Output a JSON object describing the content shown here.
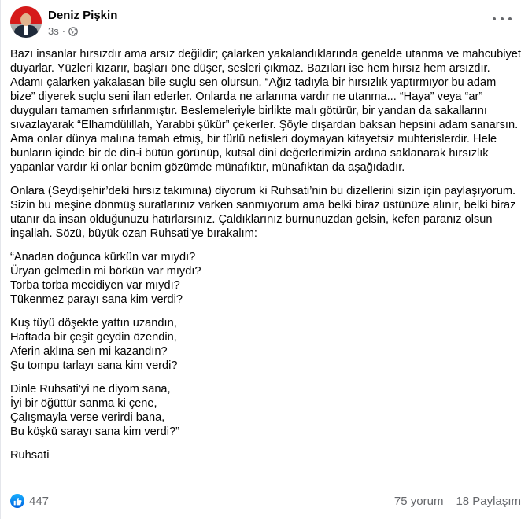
{
  "header": {
    "name": "Deniz Pişkin",
    "time": "3s",
    "separator": "·",
    "audience_icon": "globe-icon"
  },
  "post": {
    "paragraphs": [
      "Bazı insanlar hırsızdır ama arsız değildir; çalarken yakalandıklarında genelde utanma ve mahcubiyet duyarlar. Yüzleri kızarır, başları öne düşer, sesleri çıkmaz. Bazıları ise hem hırsız hem arsızdır. Adamı çalarken yakalasan bile suçlu sen olursun, “Ağız tadıyla bir hırsızlık yaptırmıyor bu adam bize” diyerek suçlu seni ilan ederler. Onlarda ne arlanma vardır ne utanma... “Haya” veya “ar” duyguları tamamen sıfırlanmıştır. Beslemeleriyle birlikte malı götürür, bir yandan da sakallarını sıvazlayarak “Elhamdülillah, Yarabbi şükür” çekerler. Şöyle dışardan baksan hepsini adam sanarsın. Ama onlar dünya malına tamah etmiş, bir türlü nefisleri doymayan kifayetsiz muhterislerdir. Hele bunların içinde bir de din-i bütün görünüp, kutsal dini değerlerimizin ardına saklanarak hırsızlık yapanlar vardır ki onlar benim gözümde münafıktır, münafıktan da aşağıdadır.",
      "Onlara (Seydişehir’deki hırsız takımına) diyorum ki Ruhsati’nin bu dizellerini sizin için paylaşıyorum. Sizin bu meşine dönmüş suratlarınız varken sanmıyorum ama belki biraz üstünüze alınır, belki biraz utanır da insan olduğunuzu hatırlarsınız. Çaldıklarınız burnunuzdan gelsin, kefen paranız olsun inşallah. Sözü, büyük ozan Ruhsati’ye bırakalım:"
    ],
    "stanzas": [
      [
        "“Anadan doğunca kürkün var mıydı?",
        "Üryan gelmedin mi börkün var mıydı?",
        "Torba torba mecidiyen var mıydı?",
        "Tükenmez parayı sana kim verdi?"
      ],
      [
        "Kuş tüyü döşekte yattın uzandın,",
        "Haftada bir çeşit geydin özendin,",
        "Aferin aklına sen mi kazandın?",
        "Şu tompu tarlayı sana kim verdi?"
      ],
      [
        "Dinle Ruhsati’yi ne diyom sana,",
        "İyi bir öğüttür sanma ki çene,",
        "Çalışmayla verse verirdi bana,",
        "Bu köşkü sarayı sana kim verdi?”"
      ]
    ],
    "signature": "Ruhsati"
  },
  "footer": {
    "reaction_icon": "like-icon",
    "reactions_count": "447",
    "comments": "75 yorum",
    "shares": "18 Paylaşım"
  },
  "colors": {
    "text": "#050505",
    "secondary": "#65676b",
    "like_blue": "#0866ff"
  }
}
